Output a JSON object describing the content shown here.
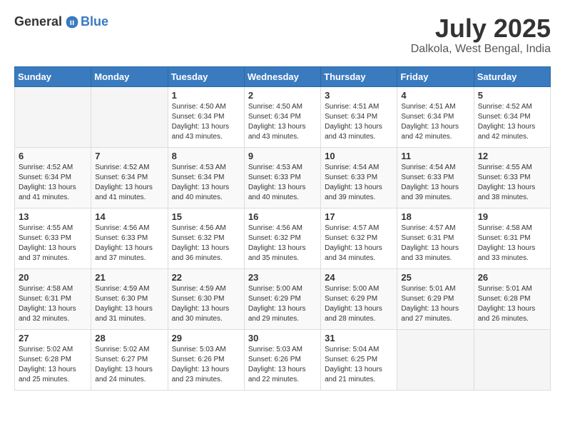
{
  "header": {
    "logo": {
      "general": "General",
      "blue": "Blue"
    },
    "title": "July 2025",
    "location": "Dalkola, West Bengal, India"
  },
  "days_of_week": [
    "Sunday",
    "Monday",
    "Tuesday",
    "Wednesday",
    "Thursday",
    "Friday",
    "Saturday"
  ],
  "weeks": [
    [
      {
        "day": "",
        "info": ""
      },
      {
        "day": "",
        "info": ""
      },
      {
        "day": "1",
        "info": "Sunrise: 4:50 AM\nSunset: 6:34 PM\nDaylight: 13 hours\nand 43 minutes."
      },
      {
        "day": "2",
        "info": "Sunrise: 4:50 AM\nSunset: 6:34 PM\nDaylight: 13 hours\nand 43 minutes."
      },
      {
        "day": "3",
        "info": "Sunrise: 4:51 AM\nSunset: 6:34 PM\nDaylight: 13 hours\nand 43 minutes."
      },
      {
        "day": "4",
        "info": "Sunrise: 4:51 AM\nSunset: 6:34 PM\nDaylight: 13 hours\nand 42 minutes."
      },
      {
        "day": "5",
        "info": "Sunrise: 4:52 AM\nSunset: 6:34 PM\nDaylight: 13 hours\nand 42 minutes."
      }
    ],
    [
      {
        "day": "6",
        "info": "Sunrise: 4:52 AM\nSunset: 6:34 PM\nDaylight: 13 hours\nand 41 minutes."
      },
      {
        "day": "7",
        "info": "Sunrise: 4:52 AM\nSunset: 6:34 PM\nDaylight: 13 hours\nand 41 minutes."
      },
      {
        "day": "8",
        "info": "Sunrise: 4:53 AM\nSunset: 6:34 PM\nDaylight: 13 hours\nand 40 minutes."
      },
      {
        "day": "9",
        "info": "Sunrise: 4:53 AM\nSunset: 6:33 PM\nDaylight: 13 hours\nand 40 minutes."
      },
      {
        "day": "10",
        "info": "Sunrise: 4:54 AM\nSunset: 6:33 PM\nDaylight: 13 hours\nand 39 minutes."
      },
      {
        "day": "11",
        "info": "Sunrise: 4:54 AM\nSunset: 6:33 PM\nDaylight: 13 hours\nand 39 minutes."
      },
      {
        "day": "12",
        "info": "Sunrise: 4:55 AM\nSunset: 6:33 PM\nDaylight: 13 hours\nand 38 minutes."
      }
    ],
    [
      {
        "day": "13",
        "info": "Sunrise: 4:55 AM\nSunset: 6:33 PM\nDaylight: 13 hours\nand 37 minutes."
      },
      {
        "day": "14",
        "info": "Sunrise: 4:56 AM\nSunset: 6:33 PM\nDaylight: 13 hours\nand 37 minutes."
      },
      {
        "day": "15",
        "info": "Sunrise: 4:56 AM\nSunset: 6:32 PM\nDaylight: 13 hours\nand 36 minutes."
      },
      {
        "day": "16",
        "info": "Sunrise: 4:56 AM\nSunset: 6:32 PM\nDaylight: 13 hours\nand 35 minutes."
      },
      {
        "day": "17",
        "info": "Sunrise: 4:57 AM\nSunset: 6:32 PM\nDaylight: 13 hours\nand 34 minutes."
      },
      {
        "day": "18",
        "info": "Sunrise: 4:57 AM\nSunset: 6:31 PM\nDaylight: 13 hours\nand 33 minutes."
      },
      {
        "day": "19",
        "info": "Sunrise: 4:58 AM\nSunset: 6:31 PM\nDaylight: 13 hours\nand 33 minutes."
      }
    ],
    [
      {
        "day": "20",
        "info": "Sunrise: 4:58 AM\nSunset: 6:31 PM\nDaylight: 13 hours\nand 32 minutes."
      },
      {
        "day": "21",
        "info": "Sunrise: 4:59 AM\nSunset: 6:30 PM\nDaylight: 13 hours\nand 31 minutes."
      },
      {
        "day": "22",
        "info": "Sunrise: 4:59 AM\nSunset: 6:30 PM\nDaylight: 13 hours\nand 30 minutes."
      },
      {
        "day": "23",
        "info": "Sunrise: 5:00 AM\nSunset: 6:29 PM\nDaylight: 13 hours\nand 29 minutes."
      },
      {
        "day": "24",
        "info": "Sunrise: 5:00 AM\nSunset: 6:29 PM\nDaylight: 13 hours\nand 28 minutes."
      },
      {
        "day": "25",
        "info": "Sunrise: 5:01 AM\nSunset: 6:29 PM\nDaylight: 13 hours\nand 27 minutes."
      },
      {
        "day": "26",
        "info": "Sunrise: 5:01 AM\nSunset: 6:28 PM\nDaylight: 13 hours\nand 26 minutes."
      }
    ],
    [
      {
        "day": "27",
        "info": "Sunrise: 5:02 AM\nSunset: 6:28 PM\nDaylight: 13 hours\nand 25 minutes."
      },
      {
        "day": "28",
        "info": "Sunrise: 5:02 AM\nSunset: 6:27 PM\nDaylight: 13 hours\nand 24 minutes."
      },
      {
        "day": "29",
        "info": "Sunrise: 5:03 AM\nSunset: 6:26 PM\nDaylight: 13 hours\nand 23 minutes."
      },
      {
        "day": "30",
        "info": "Sunrise: 5:03 AM\nSunset: 6:26 PM\nDaylight: 13 hours\nand 22 minutes."
      },
      {
        "day": "31",
        "info": "Sunrise: 5:04 AM\nSunset: 6:25 PM\nDaylight: 13 hours\nand 21 minutes."
      },
      {
        "day": "",
        "info": ""
      },
      {
        "day": "",
        "info": ""
      }
    ]
  ]
}
